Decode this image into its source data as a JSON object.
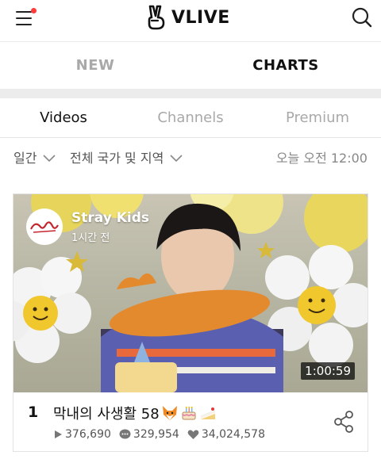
{
  "header": {
    "logo_text": "VLIVE",
    "has_notification": true
  },
  "main_tabs": [
    {
      "label": "NEW",
      "active": false
    },
    {
      "label": "CHARTS",
      "active": true
    }
  ],
  "sub_tabs": [
    {
      "label": "Videos",
      "active": true
    },
    {
      "label": "Channels",
      "active": false
    },
    {
      "label": "Premium",
      "active": false
    }
  ],
  "filters": {
    "period": "일간",
    "region": "전체 국가 및 지역",
    "updated": "오늘 오전 12:00"
  },
  "video": {
    "channel_name": "Stray Kids",
    "posted": "1시간 전",
    "duration": "1:00:59",
    "rank": "1",
    "title": "막내의 사생활 58",
    "title_emojis": [
      "fox-emoji",
      "birthday-cake-emoji",
      "cake-slice-emoji"
    ],
    "plays": "376,690",
    "comments": "329,954",
    "likes": "34,024,578"
  },
  "colors": {
    "notification_dot": "#ff3b3b",
    "inactive_tab": "#a9a9a9",
    "separator": "#ececec"
  }
}
